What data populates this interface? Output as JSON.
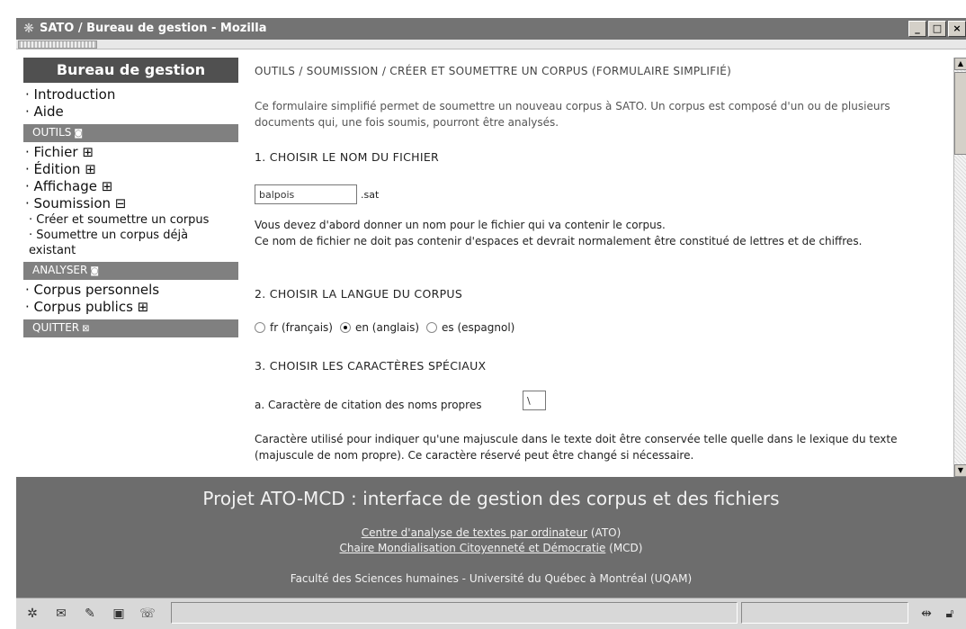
{
  "window": {
    "title": "SATO / Bureau de gestion - Mozilla",
    "buttons": [
      "_",
      "□",
      "×"
    ]
  },
  "sidebar": {
    "header": "Bureau de gestion",
    "top_links": [
      "· Introduction",
      "· Aide"
    ],
    "sections": [
      {
        "label": "OUTILS",
        "icon": "collapse-icon",
        "items": [
          {
            "label": "· Fichier ⊞"
          },
          {
            "label": "· Édition ⊞"
          },
          {
            "label": "· Affichage ⊞"
          },
          {
            "label": "· Soumission ⊟"
          }
        ],
        "subitems": [
          "· Créer et soumettre un corpus",
          "· Soumettre un corpus déjà existant"
        ]
      },
      {
        "label": "ANALYSER",
        "icon": "collapse-icon",
        "items": [
          {
            "label": "· Corpus personnels"
          },
          {
            "label": "· Corpus publics ⊞"
          }
        ]
      },
      {
        "label": "QUITTER",
        "icon": "close-icon"
      }
    ]
  },
  "content": {
    "breadcrumb": "OUTILS / SOUMISSION / CRÉER ET SOUMETTRE UN CORPUS (FORMULAIRE SIMPLIFIÉ)",
    "intro": "Ce formulaire simplifié permet de soumettre un nouveau corpus à SATO. Un corpus est composé d'un ou de plusieurs documents qui, une fois soumis, pourront être analysés.",
    "step1": {
      "heading": "1. CHOISIR LE NOM DU FICHIER",
      "value": "balpois",
      "suffix": ".sat",
      "help1": "Vous devez d'abord donner un nom pour le fichier qui va contenir le corpus.",
      "help2": "Ce nom de fichier ne doit pas contenir d'espaces et devrait normalement être constitué de lettres et de chiffres."
    },
    "step2": {
      "heading": "2. CHOISIR LA LANGUE DU CORPUS",
      "options": [
        {
          "label": "fr (français)",
          "checked": false
        },
        {
          "label": "en (anglais)",
          "checked": true
        },
        {
          "label": "es (espagnol)",
          "checked": false
        }
      ]
    },
    "step3": {
      "heading": "3. CHOISIR LES CARACTÈRES SPÉCIAUX",
      "label_a": "a. Caractère de citation des noms propres",
      "value_a": "\\",
      "help": "Caractère utilisé pour indiquer qu'une majuscule dans le texte doit être conservée telle quelle dans le lexique du texte (majuscule de nom propre). Ce caractère réservé peut être changé si nécessaire."
    }
  },
  "footer": {
    "title": "Projet ATO-MCD : interface de gestion des corpus et des fichiers",
    "link1": "Centre d'analyse de textes par ordinateur",
    "link1_suffix": " (ATO)",
    "link2": "Chaire Mondialisation Citoyenneté et Démocratie",
    "link2_suffix": " (MCD)",
    "line3": "Faculté des Sciences humaines - Université du Québec à Montréal (UQAM)"
  }
}
